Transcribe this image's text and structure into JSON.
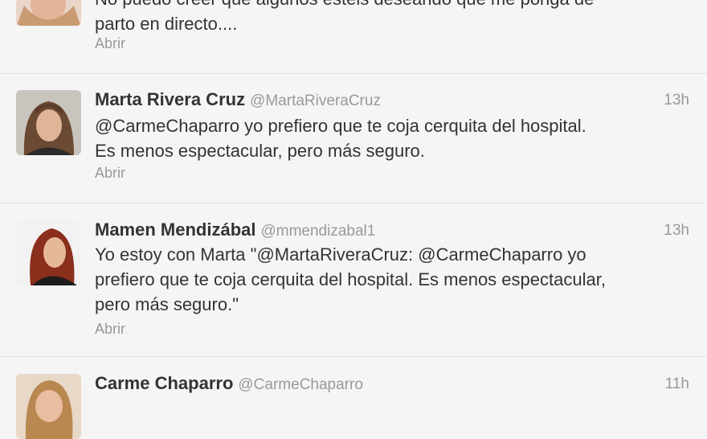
{
  "tweets": [
    {
      "name": "",
      "handle": "",
      "time": "",
      "text_lines": [
        "No puedo creer que algunos estéis deseando que me ponga de",
        "parto en directo...."
      ],
      "open_label": "Abrir"
    },
    {
      "name": "Marta Rivera Cruz",
      "handle": "@MartaRiveraCruz",
      "time": "13h",
      "text_lines": [
        "@CarmeChaparro yo prefiero que te coja cerquita del hospital.",
        "Es menos espectacular, pero más seguro."
      ],
      "open_label": "Abrir"
    },
    {
      "name": "Mamen Mendizábal",
      "handle": "@mmendizabal1",
      "time": "13h",
      "text_lines": [
        "Yo estoy con Marta \"@MartaRiveraCruz: @CarmeChaparro yo",
        "prefiero que te coja cerquita del hospital. Es menos espectacular,",
        "pero más seguro.\""
      ],
      "open_label": "Abrir"
    },
    {
      "name": "Carme Chaparro",
      "handle": "@CarmeChaparro",
      "time": "11h",
      "text_lines": [],
      "open_label": ""
    }
  ]
}
